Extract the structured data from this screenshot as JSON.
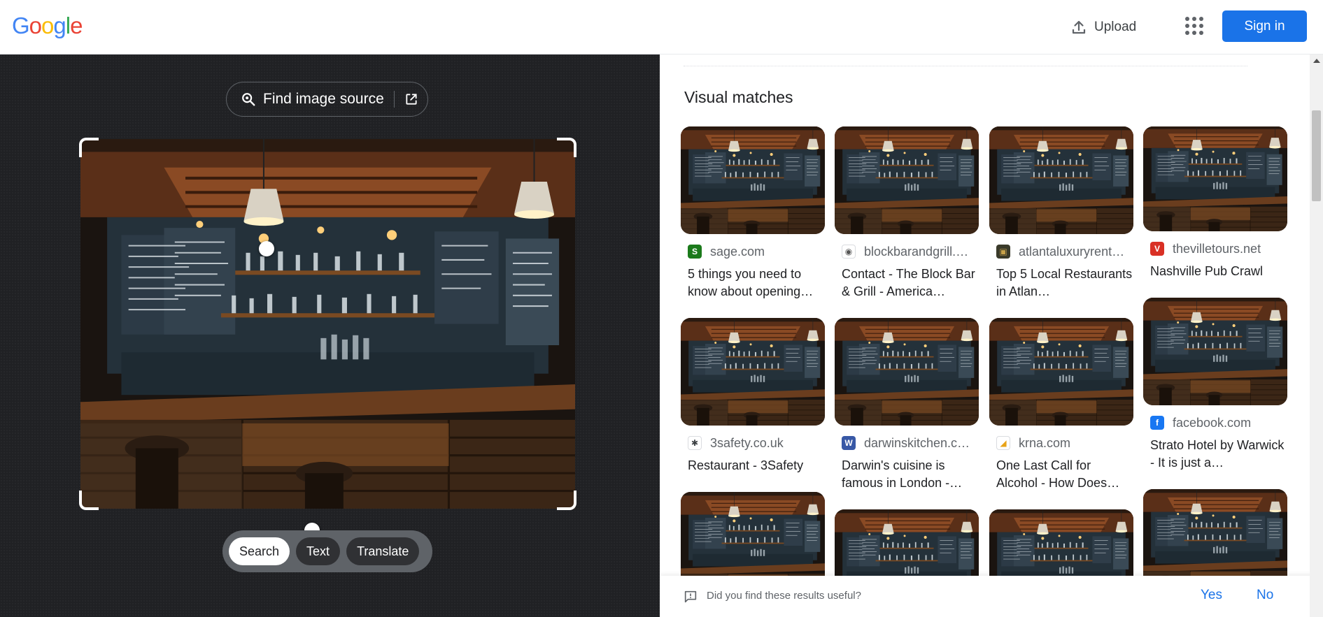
{
  "header": {
    "logo_letters": [
      {
        "ch": "G",
        "color": "#4285F4"
      },
      {
        "ch": "o",
        "color": "#EA4335"
      },
      {
        "ch": "o",
        "color": "#FBBC05"
      },
      {
        "ch": "g",
        "color": "#4285F4"
      },
      {
        "ch": "l",
        "color": "#34A853"
      },
      {
        "ch": "e",
        "color": "#EA4335"
      }
    ],
    "upload_label": "Upload",
    "signin_label": "Sign in",
    "apps_icon": "apps-grid-icon"
  },
  "lens": {
    "find_source_label": "Find image source",
    "modes": [
      {
        "label": "Search",
        "active": true
      },
      {
        "label": "Text",
        "active": false
      },
      {
        "label": "Translate",
        "active": false
      }
    ]
  },
  "results": {
    "section_title": "Visual matches",
    "cards": [
      {
        "source": "sage.com",
        "favicon": "S",
        "fav_bg": "#1b7a1b",
        "fav_fg": "#ffffff",
        "title": "5 things you need to know about opening…"
      },
      {
        "source": "blockbarandgrill.…",
        "favicon": "◉",
        "fav_bg": "#ffffff",
        "fav_fg": "#555555",
        "title": "Contact - The Block Bar & Grill - America…"
      },
      {
        "source": "atlantaluxuryrent…",
        "favicon": "▣",
        "fav_bg": "#3a3a2a",
        "fav_fg": "#c8a24a",
        "title": "Top 5 Local Restaurants in Atlan…"
      },
      {
        "source": "thevilletours.net",
        "favicon": "V",
        "fav_bg": "#d93025",
        "fav_fg": "#ffffff",
        "title": "Nashville Pub Crawl"
      },
      {
        "source": "3safety.co.uk",
        "favicon": "✱",
        "fav_bg": "#ffffff",
        "fav_fg": "#3c4043",
        "title": "Restaurant - 3Safety"
      },
      {
        "source": "darwinskitchen.c…",
        "favicon": "W",
        "fav_bg": "#3858a6",
        "fav_fg": "#ffffff",
        "title": "Darwin's cuisine is famous in London -…"
      },
      {
        "source": "krna.com",
        "favicon": "◢",
        "fav_bg": "#ffffff",
        "fav_fg": "#e8a317",
        "title": "One Last Call for Alcohol - How Does…"
      },
      {
        "source": "facebook.com",
        "favicon": "f",
        "fav_bg": "#1877f2",
        "fav_fg": "#ffffff",
        "title": "Strato Hotel by Warwick - It is just a…"
      }
    ]
  },
  "feedback": {
    "question": "Did you find these results useful?",
    "yes": "Yes",
    "no": "No"
  },
  "colors": {
    "accent": "#1a73e8",
    "left_pane_bg": "#202124"
  }
}
